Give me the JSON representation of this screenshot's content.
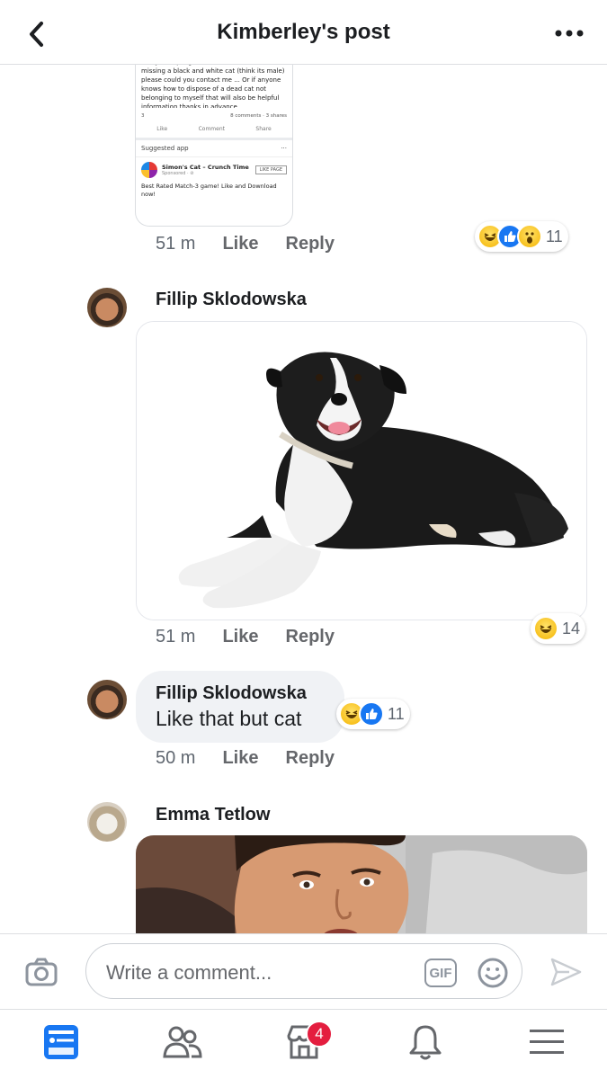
{
  "header": {
    "title": "Kimberley's post"
  },
  "shared_post": {
    "text": "cat and has died I am looking for his owner so if anyone up highread well lane or near is missing a black and white cat (think its male) please could you contact me ... Or if anyone knows how to dispose of a dead cat not belonging to myself that will also be helpful information thanks in advance",
    "reaction_count": "3",
    "stats": "8 comments · 3 shares",
    "actions": [
      "Like",
      "Comment",
      "Share"
    ],
    "suggested_label": "Suggested app",
    "suggested_more": "···",
    "app_name": "Simon's Cat – Crunch Time",
    "app_sub": "Sponsored · ⊘",
    "app_button": "LIKE PAGE",
    "footer": "Best Rated Match-3 game! Like and Download now!"
  },
  "comments": [
    {
      "time": "51 m",
      "like": "Like",
      "reply": "Reply",
      "reactions_count": "11",
      "reactions": [
        "haha",
        "like",
        "wow"
      ]
    },
    {
      "author": "Fillip Sklodowska",
      "time": "51 m",
      "like": "Like",
      "reply": "Reply",
      "reactions_count": "14",
      "reactions": [
        "haha"
      ],
      "image": "dog-photo"
    },
    {
      "author": "Fillip Sklodowska",
      "text": "Like that but cat",
      "time": "50 m",
      "like": "Like",
      "reply": "Reply",
      "reactions_count": "11",
      "reactions": [
        "haha",
        "like"
      ]
    },
    {
      "author": "Emma Tetlow",
      "image": "man-photo"
    }
  ],
  "composer": {
    "placeholder": "Write a comment...",
    "gif_label": "GIF"
  },
  "tabbar": {
    "items": [
      "news-feed-icon",
      "friends-icon",
      "marketplace-icon",
      "notifications-icon",
      "menu-icon"
    ],
    "marketplace_badge": "4"
  },
  "colors": {
    "accent": "#1877f2",
    "badge": "#e41e3f",
    "bubble": "#f0f2f5",
    "meta_text": "#606770"
  }
}
